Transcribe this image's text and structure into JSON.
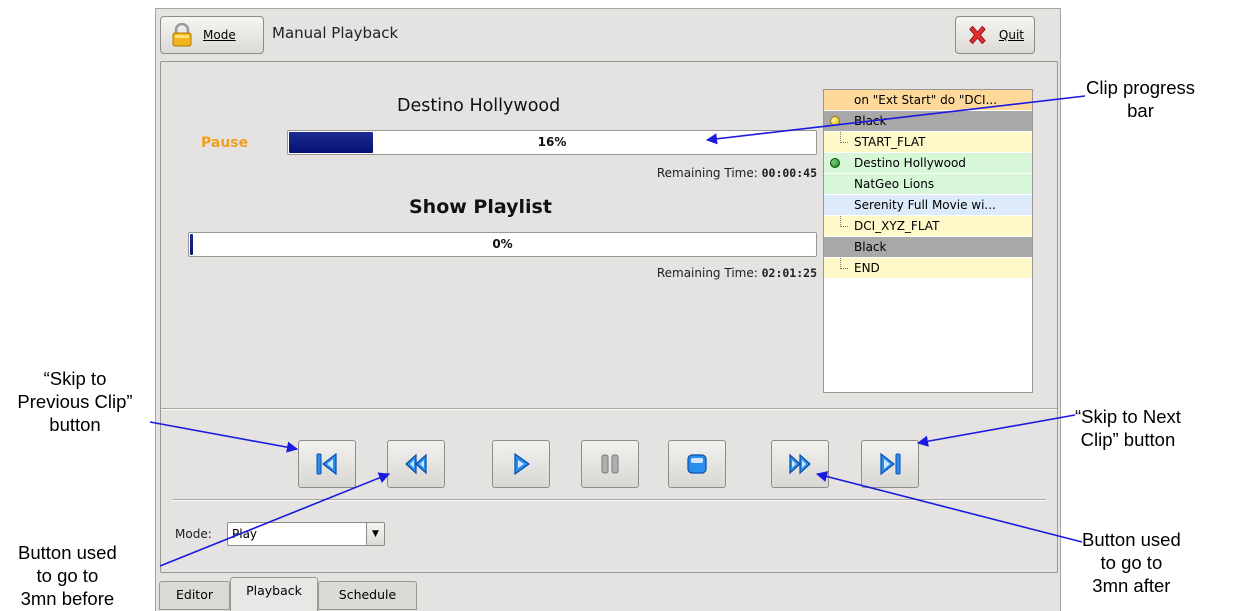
{
  "window": {
    "title": "Manual Playback",
    "mode_button_label": "Mode",
    "mode_button_icon": "lock-icon",
    "quit_button_label": "Quit",
    "quit_button_icon": "close-x-icon"
  },
  "clip": {
    "title": "Destino Hollywood",
    "status": "Pause",
    "progress": 0.16,
    "progress_label": "16%",
    "remaining_label": "Remaining Time:",
    "remaining_value": "00:00:45"
  },
  "show": {
    "title": "Show Playlist",
    "progress": 0.0,
    "progress_label": "0%",
    "remaining_label": "Remaining Time:",
    "remaining_value": "02:01:25"
  },
  "playlist": [
    {
      "label": "on \"Ext Start\" do \"DCI...",
      "style": "orange",
      "marker": "none"
    },
    {
      "label": "Black",
      "style": "gray",
      "marker": "yellow-dot"
    },
    {
      "label": "START_FLAT",
      "style": "yellow",
      "marker": "tree"
    },
    {
      "label": "Destino Hollywood",
      "style": "green",
      "marker": "green-dot"
    },
    {
      "label": "NatGeo Lions",
      "style": "green",
      "marker": "none"
    },
    {
      "label": "Serenity Full Movie wi...",
      "style": "blue",
      "marker": "none"
    },
    {
      "label": "DCI_XYZ_FLAT",
      "style": "yellow",
      "marker": "tree"
    },
    {
      "label": "Black",
      "style": "gray",
      "marker": "none"
    },
    {
      "label": "END",
      "style": "yellow",
      "marker": "tree"
    }
  ],
  "controls": [
    {
      "name": "skip-previous-clip-button",
      "icon": "skip-previous-icon"
    },
    {
      "name": "rewind-button",
      "icon": "rewind-icon"
    },
    {
      "name": "play-button",
      "icon": "play-icon"
    },
    {
      "name": "pause-button",
      "icon": "pause-icon"
    },
    {
      "name": "stop-button",
      "icon": "stop-icon"
    },
    {
      "name": "fast-forward-button",
      "icon": "fast-forward-icon"
    },
    {
      "name": "skip-next-clip-button",
      "icon": "skip-next-icon"
    }
  ],
  "mode_select": {
    "label": "Mode:",
    "value": "Play"
  },
  "tabs": [
    {
      "label": "Editor",
      "active": false
    },
    {
      "label": "Playback",
      "active": true
    },
    {
      "label": "Schedule",
      "active": false
    }
  ],
  "annotations": {
    "clip_progress": "Clip progress\nbar",
    "skip_previous": "“Skip to\nPrevious Clip”\nbutton",
    "skip_next": "“Skip to Next\nClip” button",
    "rewind": "Button used\nto go to\n3mn before",
    "fast_forward": "Button used\nto go to\n3mn after"
  },
  "colors": {
    "progress_fill": "#0b1a80",
    "pause_label": "#f0a020",
    "arrow": "#1a1ae0",
    "playlist_orange": "#ffd99a",
    "playlist_gray": "#a8a8a8",
    "playlist_green": "#d8f6d8",
    "playlist_blue": "#ddeafa",
    "playlist_yellow": "#fff8c8"
  }
}
